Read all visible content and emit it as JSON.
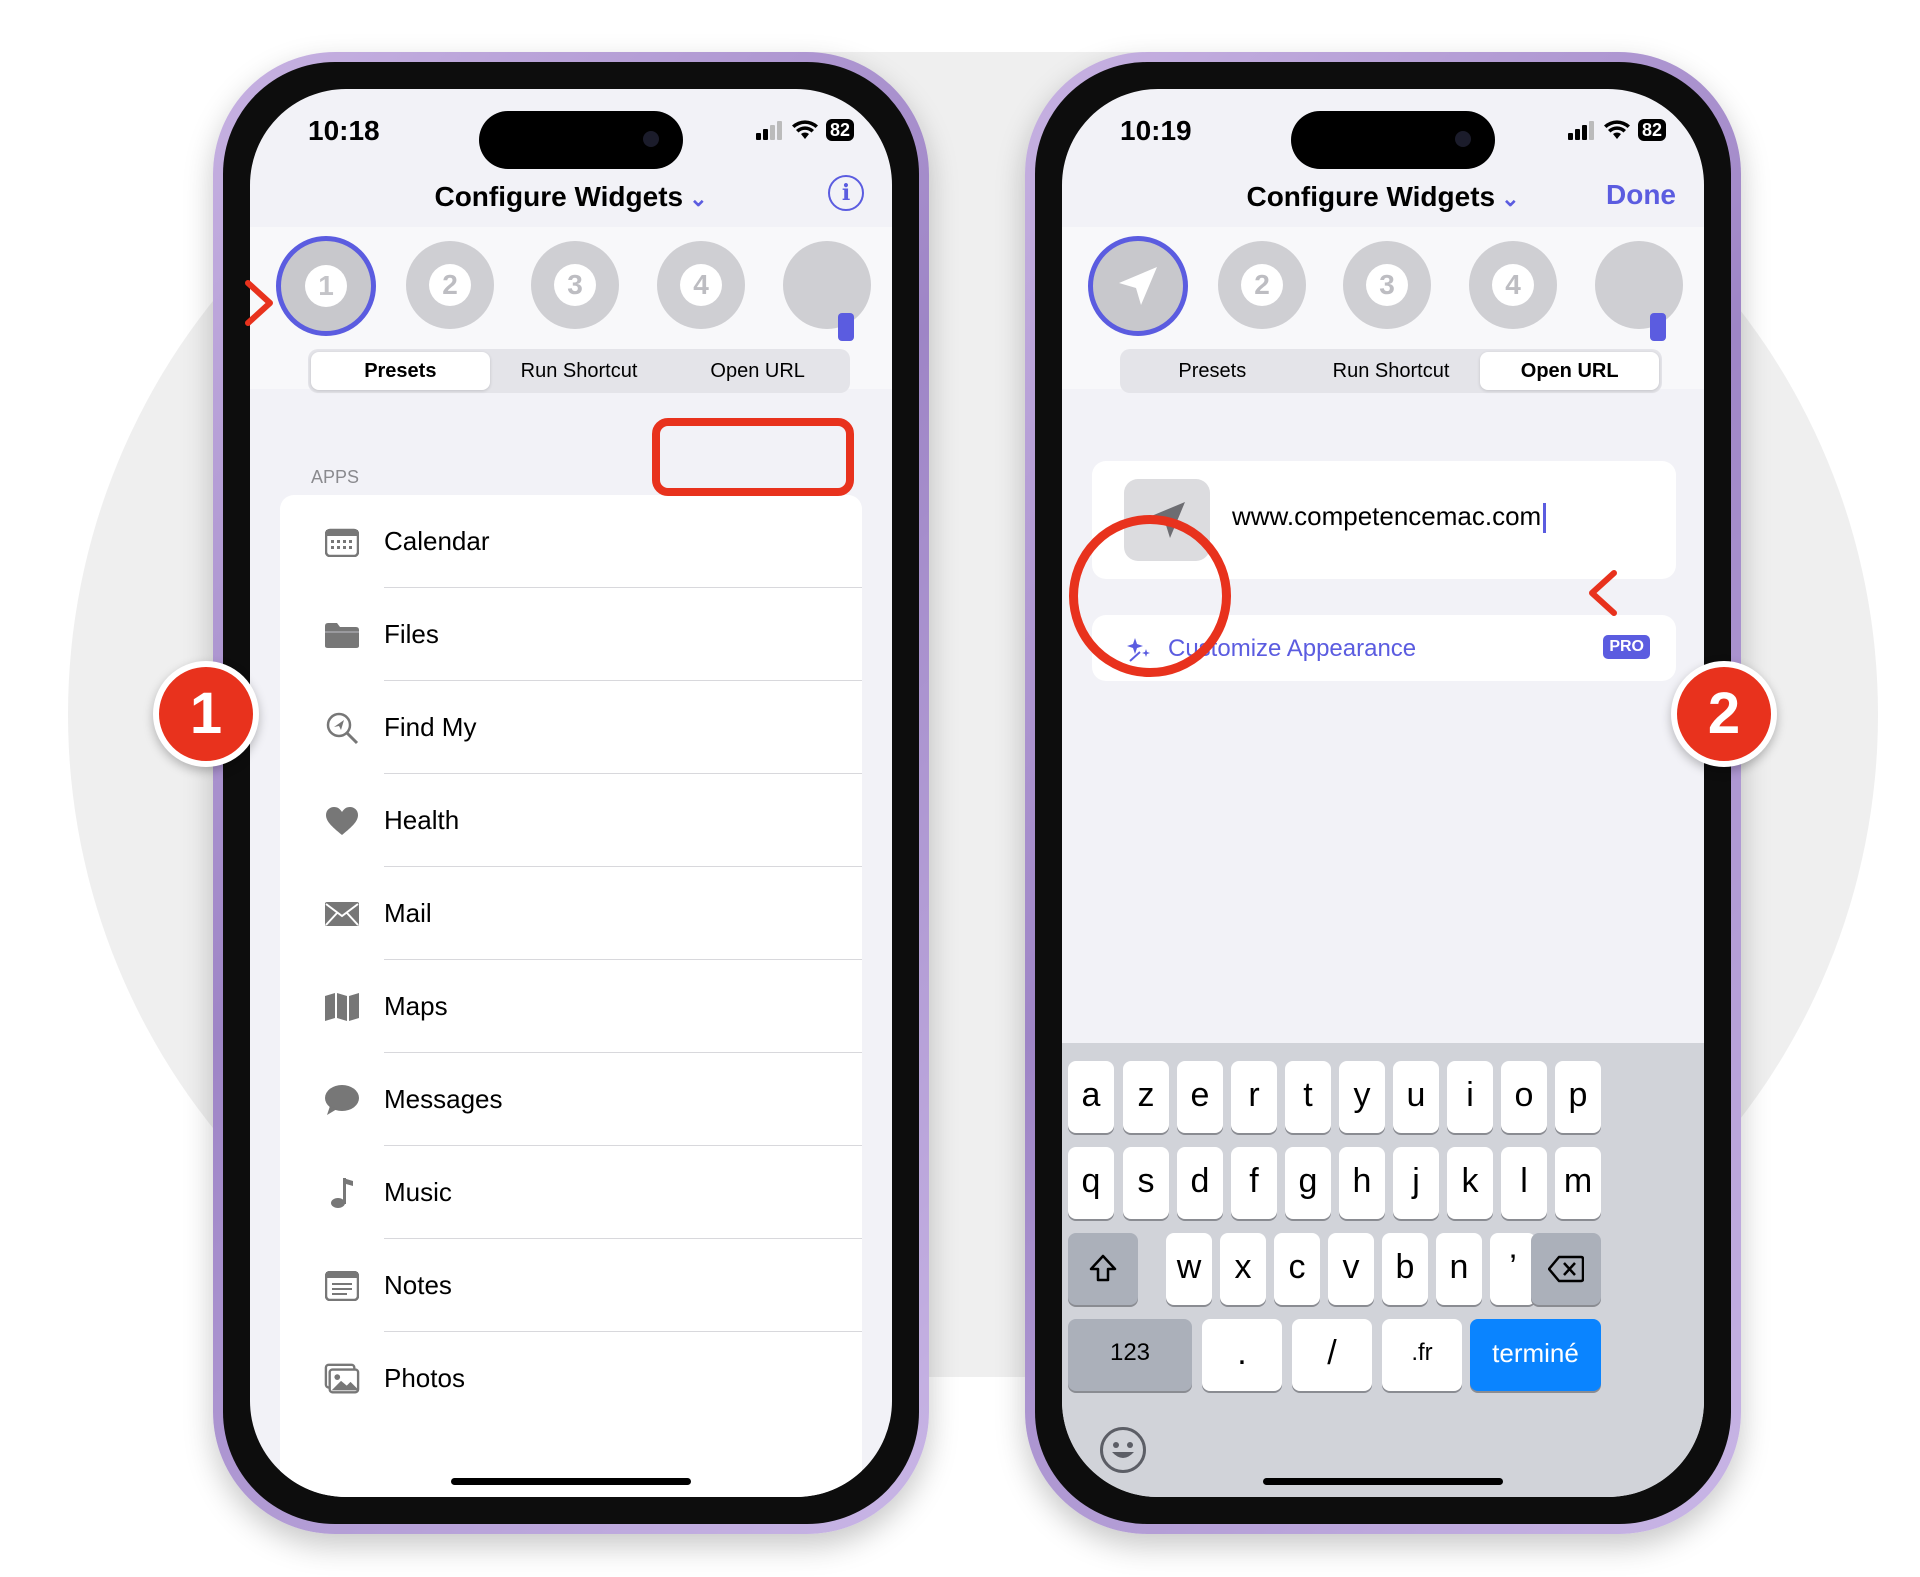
{
  "left_phone": {
    "time": "10:18",
    "battery": "82",
    "title": "Configure Widgets",
    "info_icon": "info-icon",
    "slots": [
      "1",
      "2",
      "3",
      "4"
    ],
    "segments": [
      "Presets",
      "Run Shortcut",
      "Open URL"
    ],
    "section": "APPS",
    "apps": [
      {
        "label": "Calendar",
        "icon": "calendar-icon"
      },
      {
        "label": "Files",
        "icon": "folder-icon"
      },
      {
        "label": "Find My",
        "icon": "find-my-icon"
      },
      {
        "label": "Health",
        "icon": "heart-icon"
      },
      {
        "label": "Mail",
        "icon": "envelope-icon"
      },
      {
        "label": "Maps",
        "icon": "map-icon"
      },
      {
        "label": "Messages",
        "icon": "message-bubble-icon"
      },
      {
        "label": "Music",
        "icon": "music-note-icon"
      },
      {
        "label": "Notes",
        "icon": "notes-icon"
      },
      {
        "label": "Photos",
        "icon": "photos-icon"
      }
    ]
  },
  "right_phone": {
    "time": "10:19",
    "battery": "82",
    "title": "Configure Widgets",
    "done": "Done",
    "slots": [
      "2",
      "3",
      "4"
    ],
    "segments": [
      "Presets",
      "Run Shortcut",
      "Open URL"
    ],
    "url_value": "www.competencemac.com",
    "customize": "Customize Appearance",
    "pro": "PRO",
    "keyboard": {
      "row1": [
        "a",
        "z",
        "e",
        "r",
        "t",
        "y",
        "u",
        "i",
        "o",
        "p"
      ],
      "row2": [
        "q",
        "s",
        "d",
        "f",
        "g",
        "h",
        "j",
        "k",
        "l",
        "m"
      ],
      "row3": [
        "w",
        "x",
        "c",
        "v",
        "b",
        "n",
        "’"
      ],
      "row4": [
        "123",
        ".",
        "/",
        ".fr",
        "terminé"
      ]
    }
  },
  "annotations": {
    "marker1": "1",
    "marker2": "2",
    "accent": "#e8321d",
    "brand": "#5b5ce0"
  }
}
